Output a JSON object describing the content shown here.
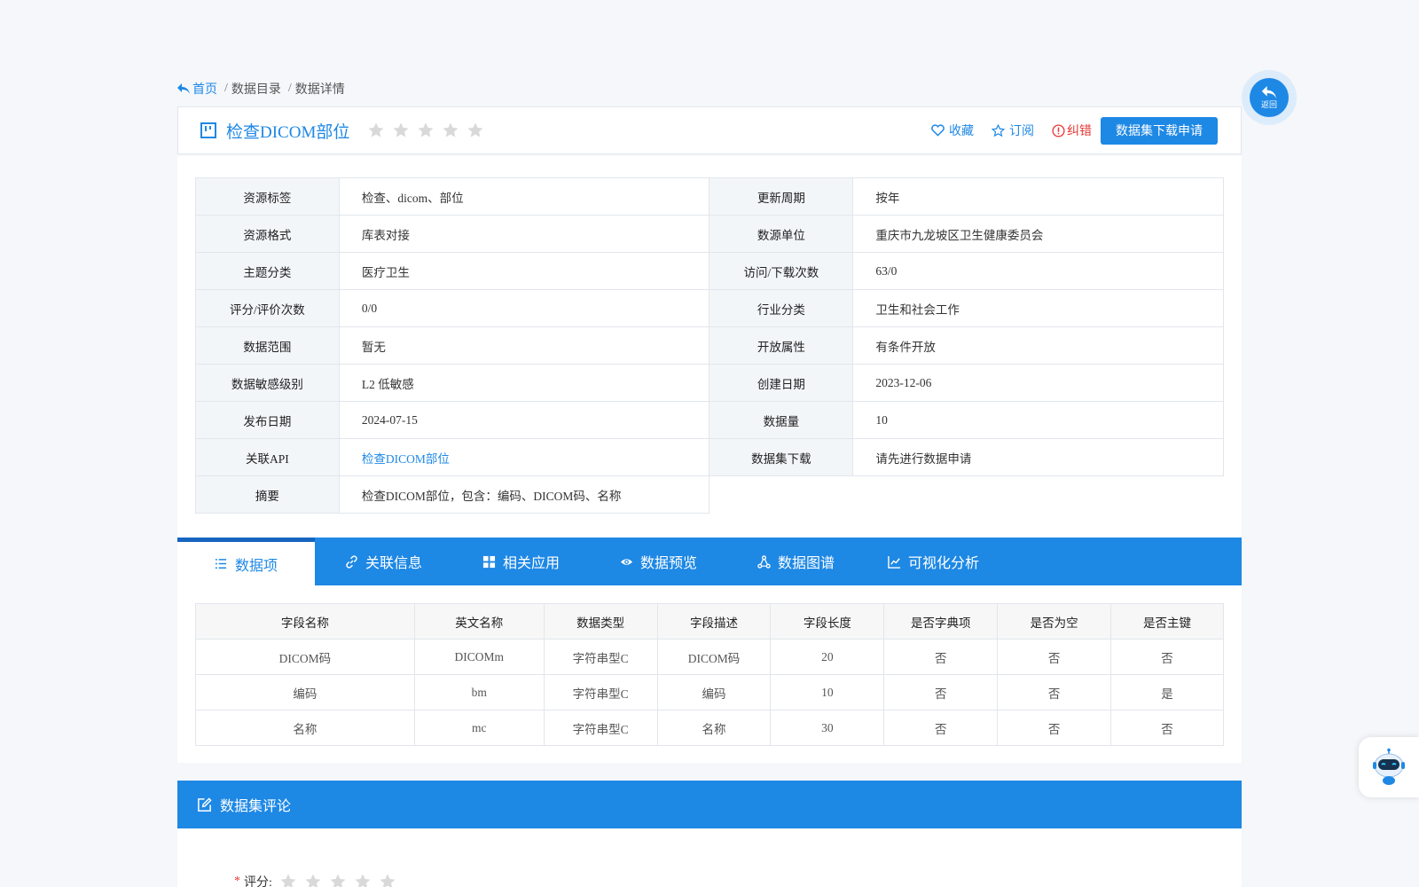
{
  "breadcrumb": {
    "home": "首页",
    "catalog": "数据目录",
    "detail": "数据详情"
  },
  "dataset": {
    "title": "检查DICOM部位",
    "rating_stars": 0,
    "actions": {
      "favorite": "收藏",
      "subscribe": "订阅",
      "report_error": "纠错",
      "download_apply": "数据集下载申请"
    }
  },
  "info": {
    "rows": [
      {
        "l1": "资源标签",
        "v1": "检查、dicom、部位",
        "l2": "更新周期",
        "v2": "按年"
      },
      {
        "l1": "资源格式",
        "v1": "库表对接",
        "l2": "数源单位",
        "v2": "重庆市九龙坡区卫生健康委员会"
      },
      {
        "l1": "主题分类",
        "v1": "医疗卫生",
        "l2": "访问/下载次数",
        "v2": "63/0"
      },
      {
        "l1": "评分/评价次数",
        "v1": "0/0",
        "l2": "行业分类",
        "v2": "卫生和社会工作"
      },
      {
        "l1": "数据范围",
        "v1": "暂无",
        "l2": "开放属性",
        "v2": "有条件开放"
      },
      {
        "l1": "数据敏感级别",
        "v1": "L2 低敏感",
        "l2": "创建日期",
        "v2": "2023-12-06"
      },
      {
        "l1": "发布日期",
        "v1": "2024-07-15",
        "l2": "数据量",
        "v2": "10"
      },
      {
        "l1": "关联API",
        "v1": "检查DICOM部位",
        "l2": "数据集下载",
        "v2": "请先进行数据申请"
      }
    ],
    "summary_label": "摘要",
    "summary_value": "检查DICOM部位，包含：编码、DICOM码、名称"
  },
  "tabs": [
    {
      "label": "数据项",
      "icon": "list-icon",
      "active": true
    },
    {
      "label": "关联信息",
      "icon": "link-icon",
      "active": false
    },
    {
      "label": "相关应用",
      "icon": "grid-icon",
      "active": false
    },
    {
      "label": "数据预览",
      "icon": "eye-icon",
      "active": false
    },
    {
      "label": "数据图谱",
      "icon": "graph-icon",
      "active": false
    },
    {
      "label": "可视化分析",
      "icon": "line-chart-icon",
      "active": false
    }
  ],
  "fields": {
    "headers": [
      "字段名称",
      "英文名称",
      "数据类型",
      "字段描述",
      "字段长度",
      "是否字典项",
      "是否为空",
      "是否主键"
    ],
    "rows": [
      [
        "DICOM码",
        "DICOMm",
        "字符串型C",
        "DICOM码",
        "20",
        "否",
        "否",
        "否"
      ],
      [
        "编码",
        "bm",
        "字符串型C",
        "编码",
        "10",
        "否",
        "否",
        "是"
      ],
      [
        "名称",
        "mc",
        "字符串型C",
        "名称",
        "30",
        "否",
        "否",
        "否"
      ]
    ]
  },
  "comments": {
    "title": "数据集评论",
    "rating_label": "评分:",
    "required_mark": "*"
  },
  "floating": {
    "back_label": "返回"
  },
  "colors": {
    "primary": "#1e88e5",
    "danger": "#e53935",
    "star_empty": "#d9d9d9"
  }
}
